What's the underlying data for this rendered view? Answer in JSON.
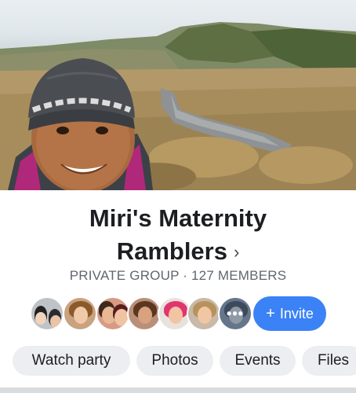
{
  "group": {
    "name_line1": "Miri's Maternity",
    "name_line2": "Ramblers",
    "chevron": "›",
    "meta": "PRIVATE GROUP · 127 MEMBERS"
  },
  "members": {
    "avatars": [
      {
        "name": "member-avatar-1",
        "palette": [
          "#9aa0a6",
          "#222222"
        ]
      },
      {
        "name": "member-avatar-2",
        "palette": [
          "#f0c9a8",
          "#8a5a2b"
        ]
      },
      {
        "name": "member-avatar-3",
        "palette": [
          "#e8b895",
          "#3d2a1c"
        ]
      },
      {
        "name": "member-avatar-4",
        "palette": [
          "#d9a27e",
          "#5b3720"
        ]
      },
      {
        "name": "member-avatar-5",
        "palette": [
          "#f2c4a3",
          "#e0356e"
        ]
      },
      {
        "name": "member-avatar-6",
        "palette": [
          "#f1c6a2",
          "#b8925d"
        ]
      },
      {
        "name": "member-avatar-7",
        "palette": [
          "#7a8797",
          "#3c4a5c"
        ]
      }
    ],
    "more_icon": "more-dots-icon",
    "more_glyph": "•••"
  },
  "invite": {
    "icon": "plus-icon",
    "icon_glyph": "+",
    "label": "Invite",
    "color": "#3b82f6"
  },
  "tabs": [
    {
      "label": "Watch party"
    },
    {
      "label": "Photos"
    },
    {
      "label": "Events"
    },
    {
      "label": "Files"
    }
  ],
  "colors": {
    "title": "#1c1e21",
    "meta": "#606770",
    "tab_bg": "#eceef1"
  }
}
